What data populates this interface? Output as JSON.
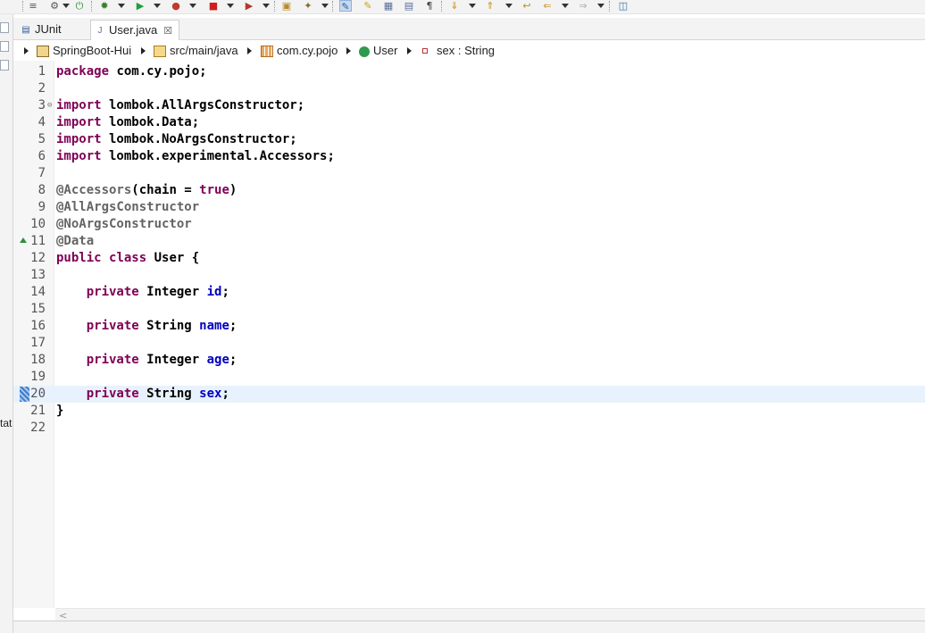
{
  "toolbar": {
    "icons": [
      "outline-icon",
      "skip-icon",
      "debug-icon",
      "bug-icon",
      "run-icon",
      "coverage-icon",
      "stop-icon",
      "external-tools-icon",
      "new-project-icon",
      "open-task-icon",
      "toggle-mark-occurrences-icon",
      "toggle-highlight-icon",
      "toggle-block-select-icon",
      "show-whitespace-icon",
      "next-annotation-icon",
      "previous-annotation-icon",
      "last-edit-icon",
      "back-icon",
      "forward-icon",
      "open-perspective-icon"
    ]
  },
  "left_strip": {
    "clipped_text": "tat"
  },
  "tabs": [
    {
      "label": "JUnit",
      "icon": "junit-icon",
      "active": false
    },
    {
      "label": "User.java",
      "icon": "java-file-icon",
      "active": true,
      "close": "☒"
    }
  ],
  "breadcrumb": [
    {
      "label": "SpringBoot-Hui",
      "icon": "project-icon"
    },
    {
      "label": "src/main/java",
      "icon": "source-folder-icon"
    },
    {
      "label": "com.cy.pojo",
      "icon": "package-icon"
    },
    {
      "label": "User",
      "icon": "class-icon"
    },
    {
      "label": "sex : String",
      "icon": "field-icon"
    }
  ],
  "editor": {
    "file": "User.java",
    "current_line": 20,
    "lines": [
      {
        "n": "1",
        "tokens": [
          [
            "kw",
            "package"
          ],
          [
            "",
            " com.cy.pojo;"
          ]
        ]
      },
      {
        "n": "2",
        "tokens": []
      },
      {
        "n": "3",
        "fold": "⊖",
        "tokens": [
          [
            "kw",
            "import"
          ],
          [
            "",
            " lombok.AllArgsConstructor;"
          ]
        ]
      },
      {
        "n": "4",
        "tokens": [
          [
            "kw",
            "import"
          ],
          [
            "",
            " lombok.Data;"
          ]
        ]
      },
      {
        "n": "5",
        "tokens": [
          [
            "kw",
            "import"
          ],
          [
            "",
            " lombok.NoArgsConstructor;"
          ]
        ]
      },
      {
        "n": "6",
        "tokens": [
          [
            "kw",
            "import"
          ],
          [
            "",
            " lombok.experimental.Accessors;"
          ]
        ]
      },
      {
        "n": "7",
        "tokens": []
      },
      {
        "n": "8",
        "tokens": [
          [
            "ann",
            "@Accessors"
          ],
          [
            "",
            "(chain = "
          ],
          [
            "kw",
            "true"
          ],
          [
            "",
            ")"
          ]
        ]
      },
      {
        "n": "9",
        "tokens": [
          [
            "ann",
            "@AllArgsConstructor"
          ]
        ]
      },
      {
        "n": "10",
        "tokens": [
          [
            "ann",
            "@NoArgsConstructor"
          ]
        ]
      },
      {
        "n": "11",
        "marker": "override",
        "tokens": [
          [
            "ann",
            "@Data"
          ]
        ]
      },
      {
        "n": "12",
        "tokens": [
          [
            "kw",
            "public"
          ],
          [
            "",
            " "
          ],
          [
            "kw",
            "class"
          ],
          [
            "",
            " User {"
          ]
        ]
      },
      {
        "n": "13",
        "tokens": []
      },
      {
        "n": "14",
        "tokens": [
          [
            "",
            "    "
          ],
          [
            "kw",
            "private"
          ],
          [
            "",
            " Integer "
          ],
          [
            "fld",
            "id"
          ],
          [
            "",
            ";"
          ]
        ]
      },
      {
        "n": "15",
        "tokens": []
      },
      {
        "n": "16",
        "tokens": [
          [
            "",
            "    "
          ],
          [
            "kw",
            "private"
          ],
          [
            "",
            " String "
          ],
          [
            "fld",
            "name"
          ],
          [
            "",
            ";"
          ]
        ]
      },
      {
        "n": "17",
        "tokens": []
      },
      {
        "n": "18",
        "tokens": [
          [
            "",
            "    "
          ],
          [
            "kw",
            "private"
          ],
          [
            "",
            " Integer "
          ],
          [
            "fld",
            "age"
          ],
          [
            "",
            ";"
          ]
        ]
      },
      {
        "n": "19",
        "tokens": []
      },
      {
        "n": "20",
        "marker": "changed",
        "tokens": [
          [
            "",
            "    "
          ],
          [
            "kw",
            "private"
          ],
          [
            "",
            " String "
          ],
          [
            "fld",
            "sex"
          ],
          [
            "",
            ";"
          ]
        ]
      },
      {
        "n": "21",
        "tokens": [
          [
            "",
            "}"
          ]
        ]
      },
      {
        "n": "22",
        "tokens": []
      }
    ]
  },
  "scroll": {
    "left_arrow": "<"
  },
  "colors": {
    "keyword": "#7f0055",
    "annotation": "#646464",
    "field": "#0000c0",
    "current_line": "#e8f2fe"
  }
}
